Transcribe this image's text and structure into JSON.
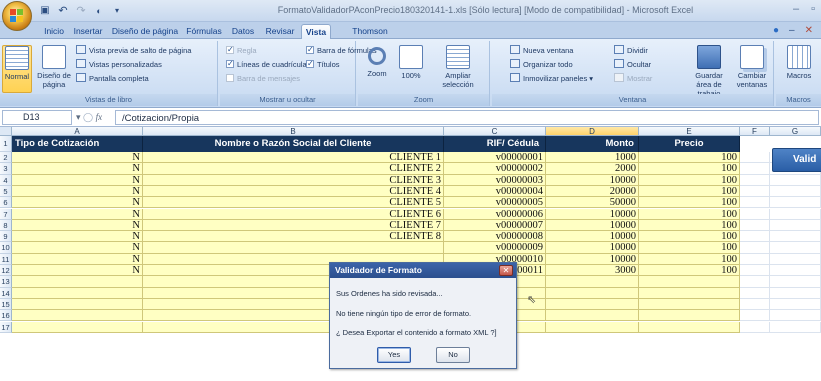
{
  "window": {
    "title": "FormatoValidadorPAconPrecio180320141-1.xls  [Sólo lectura]  [Modo de compatibilidad] - Microsoft Excel"
  },
  "tabs": [
    "Inicio",
    "Insertar",
    "Diseño de página",
    "Fórmulas",
    "Datos",
    "Revisar",
    "Vista",
    "Thomson Reuters"
  ],
  "active_tab": "Vista",
  "ribbon": {
    "vistas_libro": {
      "normal": "Normal",
      "diseno": "Diseño de página",
      "salto": "Vista previa de salto de página",
      "personalizadas": "Vistas personalizadas",
      "pantalla": "Pantalla completa",
      "label": "Vistas de libro"
    },
    "mostrar": {
      "regla": "Regla",
      "lineas": "Líneas de cuadrícula",
      "barra_mensajes": "Barra de mensajes",
      "barra_formulas": "Barra de fórmulas",
      "titulos": "Títulos",
      "label": "Mostrar u ocultar"
    },
    "zoom": {
      "zoom": "Zoom",
      "cien": "100%",
      "ampliar": "Ampliar selección",
      "label": "Zoom"
    },
    "ventana": {
      "nueva": "Nueva ventana",
      "organizar": "Organizar todo",
      "inmovilizar": "Inmovilizar paneles",
      "dividir": "Dividir",
      "ocultar": "Ocultar",
      "mostrar": "Mostrar",
      "guardar": "Guardar área de trabajo",
      "cambiar": "Cambiar ventanas",
      "label": "Ventana"
    },
    "macros": {
      "macros": "Macros",
      "label": "Macros"
    }
  },
  "formula_bar": {
    "name_box": "D13",
    "fx": "fx",
    "formula": "/Cotizacion/Propia"
  },
  "columns": [
    "A",
    "B",
    "C",
    "D",
    "E",
    "F",
    "G"
  ],
  "headers": [
    "Tipo de Cotización",
    "Nombre o Razón Social del Cliente",
    "RIF/ Cédula",
    "Monto",
    "Precio"
  ],
  "rows": [
    {
      "num": "2",
      "tipo": "N",
      "nombre": "CLIENTE 1",
      "rif": "v00000001",
      "monto": "1000",
      "precio": "100"
    },
    {
      "num": "3",
      "tipo": "N",
      "nombre": "CLIENTE 2",
      "rif": "v00000002",
      "monto": "2000",
      "precio": "100"
    },
    {
      "num": "4",
      "tipo": "N",
      "nombre": "CLIENTE 3",
      "rif": "v00000003",
      "monto": "10000",
      "precio": "100"
    },
    {
      "num": "5",
      "tipo": "N",
      "nombre": "CLIENTE 4",
      "rif": "v00000004",
      "monto": "20000",
      "precio": "100"
    },
    {
      "num": "6",
      "tipo": "N",
      "nombre": "CLIENTE 5",
      "rif": "v00000005",
      "monto": "50000",
      "precio": "100"
    },
    {
      "num": "7",
      "tipo": "N",
      "nombre": "CLIENTE 6",
      "rif": "v00000006",
      "monto": "10000",
      "precio": "100"
    },
    {
      "num": "8",
      "tipo": "N",
      "nombre": "CLIENTE 7",
      "rif": "v00000007",
      "monto": "10000",
      "precio": "100"
    },
    {
      "num": "9",
      "tipo": "N",
      "nombre": "CLIENTE 8",
      "rif": "v00000008",
      "monto": "10000",
      "precio": "100"
    },
    {
      "num": "10",
      "tipo": "N",
      "nombre": "",
      "rif": "v00000009",
      "monto": "10000",
      "precio": "100"
    },
    {
      "num": "11",
      "tipo": "N",
      "nombre": "",
      "rif": "v00000010",
      "monto": "10000",
      "precio": "100"
    },
    {
      "num": "12",
      "tipo": "N",
      "nombre": "",
      "rif": "v00000011",
      "monto": "3000",
      "precio": "100"
    }
  ],
  "empty_rows": [
    "13",
    "14",
    "15",
    "16",
    "17"
  ],
  "header_row_num": "1",
  "validate_button": "Valid",
  "dialog": {
    "title": "Validador de Formato",
    "line1": "Sus Ordenes ha sido revisada...",
    "line2": "No tiene ningún tipo de error de formato.",
    "line3": "¿ Desea Exportar el contenido a formato XML ?]",
    "yes": "Yes",
    "no": "No",
    "close": "✕"
  },
  "colors": {
    "header_bg": "#17365d",
    "cell_bg": "#ffffc3",
    "button_bg": "#2a5ea6"
  }
}
